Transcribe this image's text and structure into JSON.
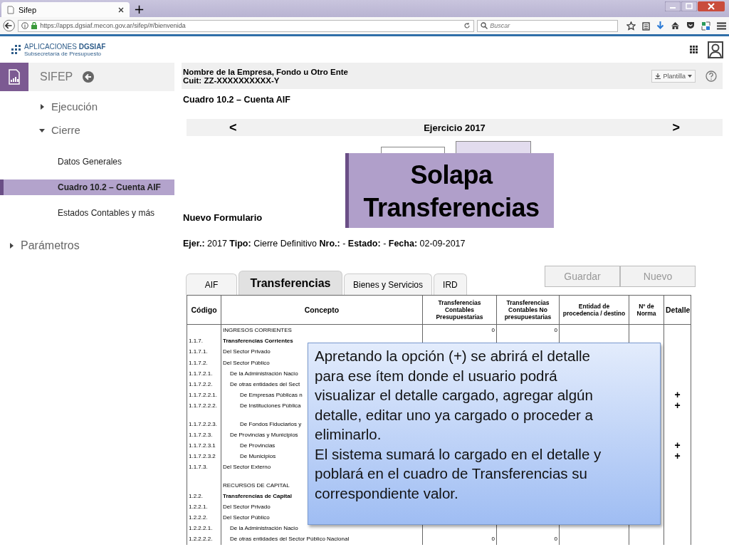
{
  "browser": {
    "tab_title": "Sifep",
    "new_tab": "+",
    "url": "https://apps.dgsiaf.mecon.gov.ar/sifep/#/bienvenida",
    "search_placeholder": "Buscar"
  },
  "app_header": {
    "logo": "APLICACIONES **DGSIAF**",
    "logo_subtitle": "Subsecretaría de Presupuesto"
  },
  "sidebar": {
    "title": "SIFEP",
    "items": [
      {
        "label": "Ejecución",
        "expanded": false
      },
      {
        "label": "Cierre",
        "expanded": true,
        "children": [
          {
            "label": "Datos Generales",
            "selected": false
          },
          {
            "label": "Cuadro 10.2  – Cuenta AIF",
            "selected": true
          },
          {
            "label": "Estados Contables y más",
            "selected": false
          }
        ]
      },
      {
        "label": "Parámetros",
        "expanded": false
      }
    ]
  },
  "entity": {
    "name": "Nombre de la Empresa, Fondo u Otro Ente",
    "cuit": "Cuit: ZZ-XXXXXXXXXX-Y",
    "template_button": "Plantilla"
  },
  "page_title": "Cuadro 10.2  – Cuenta AIF",
  "year_bar": {
    "prev": "<",
    "label": "Ejercicio 2017",
    "next": ">"
  },
  "form_title": "Nuevo Formulario",
  "form_info": "**Ejer.:** 2017 **Tipo:** Cierre Definitivo **Nro.:** -  **Estado:** -  **Fecha:** 02-09-2017",
  "buttons": [
    "Guardar",
    "Nuevo"
  ],
  "tabs": [
    {
      "label": "AIF",
      "selected": false
    },
    {
      "label": "Transferencias",
      "selected": true
    },
    {
      "label": "Bienes y Servicios",
      "selected": false
    },
    {
      "label": "IRD",
      "selected": false
    }
  ],
  "table": {
    "columns": [
      "Código",
      "Concepto",
      "Transferencias Contables Presupuestarias",
      "Transferencias Contables No presupuestarias",
      "Entidad de procedencia / destino",
      "Nº de Norma",
      "Detalle"
    ],
    "rows": [
      {
        "kind": "section",
        "code": "",
        "concept": "INGRESOS CORRIENTES",
        "budget": "0",
        "non_budget": "0",
        "detail": ""
      },
      {
        "kind": "total",
        "code": "1.1.7.",
        "concept": "Transferencias Corrientes",
        "budget": "",
        "non_budget": "",
        "detail": ""
      },
      {
        "kind": "plain",
        "code": "1.1.7.1.",
        "concept": "Del Sector Privado",
        "budget": "",
        "non_budget": "",
        "detail": ""
      },
      {
        "kind": "plain",
        "code": "1.1.7.2.",
        "concept": "Del Sector Público",
        "budget": "",
        "non_budget": "",
        "detail": ""
      },
      {
        "kind": "sub",
        "code": "1.1.7.2.1.",
        "concept": "De la Administración Nacio",
        "budget": "",
        "non_budget": "",
        "detail": ""
      },
      {
        "kind": "sub",
        "code": "1.1.7.2.2.",
        "concept": "De otras entidades del Sect",
        "budget": "",
        "non_budget": "",
        "detail": ""
      },
      {
        "kind": "subsub",
        "code": "1.1.7.2.2.1.",
        "concept": "De Empresas Públicas n",
        "budget": "",
        "non_budget": "",
        "detail": "+"
      },
      {
        "kind": "subsub",
        "code": "1.1.7.2.2.2.",
        "concept": "De Instituciones Pública",
        "budget": "",
        "non_budget": "",
        "detail": "+"
      },
      {
        "kind": "spacer",
        "code": "",
        "concept": "",
        "budget": "",
        "non_budget": "",
        "detail": ""
      },
      {
        "kind": "subsub",
        "code": "1.1.7.2.2.3.",
        "concept": "De Fondos Fiduciarios y",
        "budget": "",
        "non_budget": "",
        "detail": ""
      },
      {
        "kind": "sub",
        "code": "1.1.7.2.3.",
        "concept": "De Provincias y Municipios",
        "budget": "",
        "non_budget": "",
        "detail": ""
      },
      {
        "kind": "subsub",
        "code": "1.1.7.2.3.1",
        "concept": "De Provincias",
        "budget": "",
        "non_budget": "",
        "detail": "+"
      },
      {
        "kind": "subsub",
        "code": "1.1.7.2.3.2",
        "concept": "De Municipios",
        "budget": "",
        "non_budget": "",
        "detail": "+"
      },
      {
        "kind": "plain",
        "code": "1.1.7.3.",
        "concept": "Del Sector Externo",
        "budget": "",
        "non_budget": "",
        "detail": ""
      },
      {
        "kind": "spacer",
        "code": "",
        "concept": "",
        "budget": "",
        "non_budget": "",
        "detail": ""
      },
      {
        "kind": "section",
        "code": "",
        "concept": "RECURSOS DE CAPITAL",
        "budget": "",
        "non_budget": "",
        "detail": ""
      },
      {
        "kind": "total",
        "code": "1.2.2.",
        "concept": "Transferencias de Capital",
        "budget": "",
        "non_budget": "",
        "detail": ""
      },
      {
        "kind": "plain",
        "code": "1.2.2.1.",
        "concept": "Del Sector Privado",
        "budget": "",
        "non_budget": "",
        "detail": ""
      },
      {
        "kind": "plain",
        "code": "1.2.2.2.",
        "concept": "Del Sector Público",
        "budget": "",
        "non_budget": "",
        "detail": ""
      },
      {
        "kind": "sub",
        "code": "1.2.2.2.1.",
        "concept": "De la Administración Nacio",
        "budget": "",
        "non_budget": "",
        "detail": ""
      },
      {
        "kind": "sub",
        "code": "1.2.2.2.2.",
        "concept": "De otras entidades del Sector Público Nacional",
        "budget": "0",
        "non_budget": "0",
        "detail": ""
      }
    ]
  },
  "callouts": {
    "tab_label": "Solapa Transferencias",
    "note": [
      "Apretando la opción (+) se abrirá el detalle para ese ítem donde el usuario podrá visualizar el detalle cargado, agregar algún detalle, editar uno ya cargado o proceder a eliminarlo.",
      "El sistema sumará lo cargado en el detalle y poblará en el cuadro de Transferencias su correspondiente valor."
    ]
  }
}
